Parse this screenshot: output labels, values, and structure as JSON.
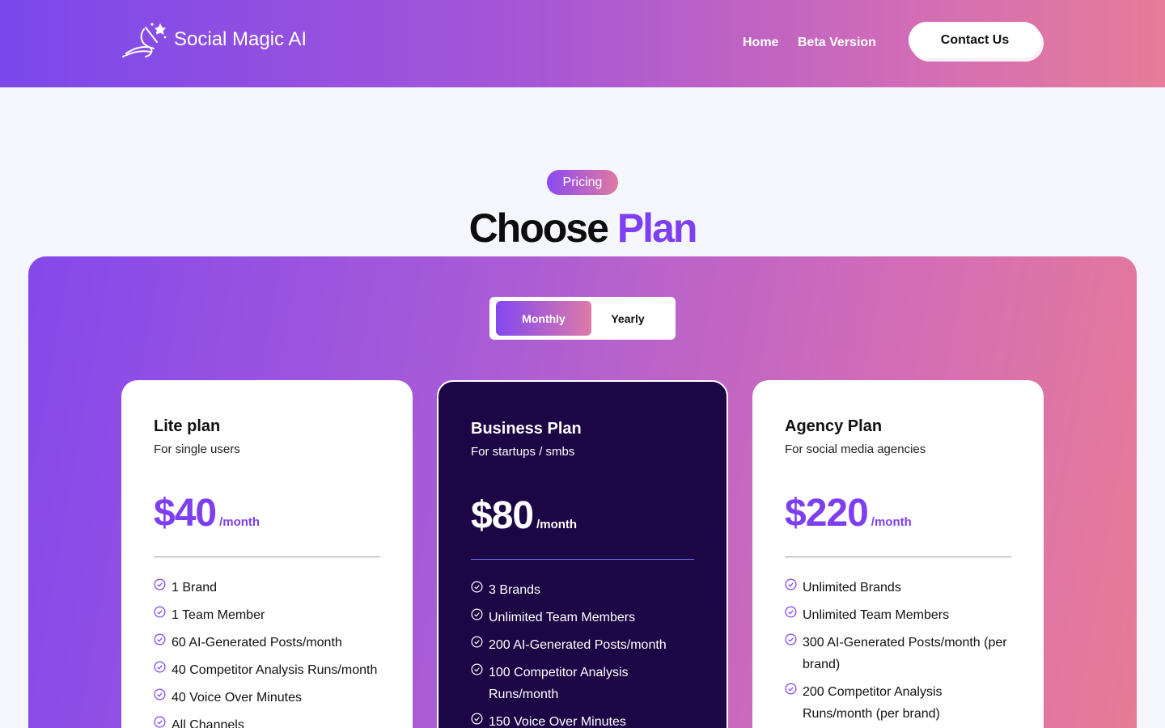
{
  "header": {
    "brand": "Social Magic AI",
    "nav": [
      {
        "label": "Home"
      },
      {
        "label": "Beta Version"
      }
    ],
    "contact_label": "Contact Us"
  },
  "hero": {
    "badge": "Pricing",
    "title_main": "Choose",
    "title_accent": "Plan"
  },
  "billing_toggle": {
    "monthly": "Monthly",
    "yearly": "Yearly",
    "selected": "Monthly"
  },
  "plans": [
    {
      "name": "Lite plan",
      "subtitle": "For single users",
      "price": "$40",
      "period": "/month",
      "features": [
        "1 Brand",
        "1 Team Member",
        "60 AI-Generated Posts/month",
        "40 Competitor Analysis Runs/month",
        "40 Voice Over Minutes",
        "All Channels"
      ]
    },
    {
      "name": "Business Plan",
      "subtitle": "For startups / smbs",
      "price": "$80",
      "period": "/month",
      "features": [
        "3 Brands",
        "Unlimited Team Members",
        "200 AI-Generated Posts/month",
        "100 Competitor Analysis Runs/month",
        "150 Voice Over Minutes"
      ]
    },
    {
      "name": "Agency Plan",
      "subtitle": "For social media agencies",
      "price": "$220",
      "period": "/month",
      "features": [
        "Unlimited Brands",
        "Unlimited Team Members",
        "300 AI-Generated Posts/month (per brand)",
        "200 Competitor Analysis Runs/month (per brand)"
      ]
    }
  ],
  "colors": {
    "accent": "#7d3ff0",
    "dark_card": "#1c0645",
    "gradient_start": "#7b48ec",
    "gradient_end": "#e67c98"
  },
  "icons": {
    "logo": "magic-wand-icon",
    "feature": "check-circle-icon"
  }
}
